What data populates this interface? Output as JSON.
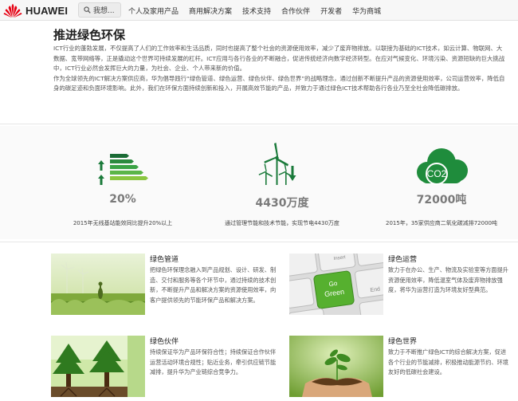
{
  "brand": {
    "name": "HUAWEI",
    "color": "#e60012"
  },
  "search": {
    "label": "我想..."
  },
  "nav": [
    "个人及家用产品",
    "商用解决方案",
    "技术支持",
    "合作伙伴",
    "开发者",
    "华为商城"
  ],
  "intro": {
    "title": "推进绿色环保",
    "paragraphs": [
      "ICT行业的蓬勃发展，不仅提高了人们的工作效率和生活品质，同时也提高了整个社会的资源使用效率，减少了废弃物排放。以联接为基础的ICT技术，如云计算、物联网、大数据、宽带网络等，正是撬动这个世界可持续发展的杠杆。ICT应用与各行各业的不断融合，促进传统经济向数字经济转型。在应对气候变化、环境污染、资源短缺的巨大挑战中，ICT行业必然会发挥巨大的力量，为社会、企业、个人带来新的价值。",
      "作为全球领先的ICT解决方案供应商，华为倡导践行“绿色管道、绿色运营、绿色伙伴、绿色世界”的战略理念，通过创新不断提升产品的资源使用效率，公司运营效率，降低自身的碳足迹和负面环境影响。此外，我们在环保方面持续创新和投入，开展高效节能的产品，并致力于通过绿色ICT技术帮助各行各业乃至全社会降低碳排放。"
    ]
  },
  "stats": [
    {
      "value": "20%",
      "caption": "2015年无线基站能效同比提升20%以上",
      "icon": "energy-rating-icon"
    },
    {
      "value": "4430万度",
      "caption": "通过管理节能和技术节能，实现节电4430万度",
      "icon": "wind-turbine-icon"
    },
    {
      "value": "72000吨",
      "caption": "2015年，35家供应商二氧化碳减排72000吨",
      "icon": "co2-cloud-icon"
    }
  ],
  "co2_label": "CO2",
  "features": [
    {
      "title": "绿色管道",
      "text": "把绿色环保理念融入到产品规划、设计、研发、制造、交付和服务等各个环节中，通过持续的技术创新，不断提升产品和解决方案的资源使用效率，向客户提供领先的节能环保产品和解决方案。"
    },
    {
      "title": "绿色运营",
      "text": "致力于在办公、生产、物流及实验室等方面提升资源使用效率，降低温室气体及废弃物排放强度，将华为运营打造为环境友好型典范。"
    },
    {
      "title": "绿色伙伴",
      "text": "持续保证华为产品环保符合性；持续保证合作伙伴运营活动环境合规性；贴近业务，牵引供应链节能减排，提升华为产业链综合竞争力。"
    },
    {
      "title": "绿色世界",
      "text": "致力于不断推广绿色ICT的综合解决方案，促进各个行业的节能减排，积极推动能源节约、环境友好的低碳社会建设。"
    }
  ],
  "keyboard": {
    "key_top": "Go",
    "key_bottom": "Green",
    "key_right": "End",
    "key_upper": "Insert"
  }
}
